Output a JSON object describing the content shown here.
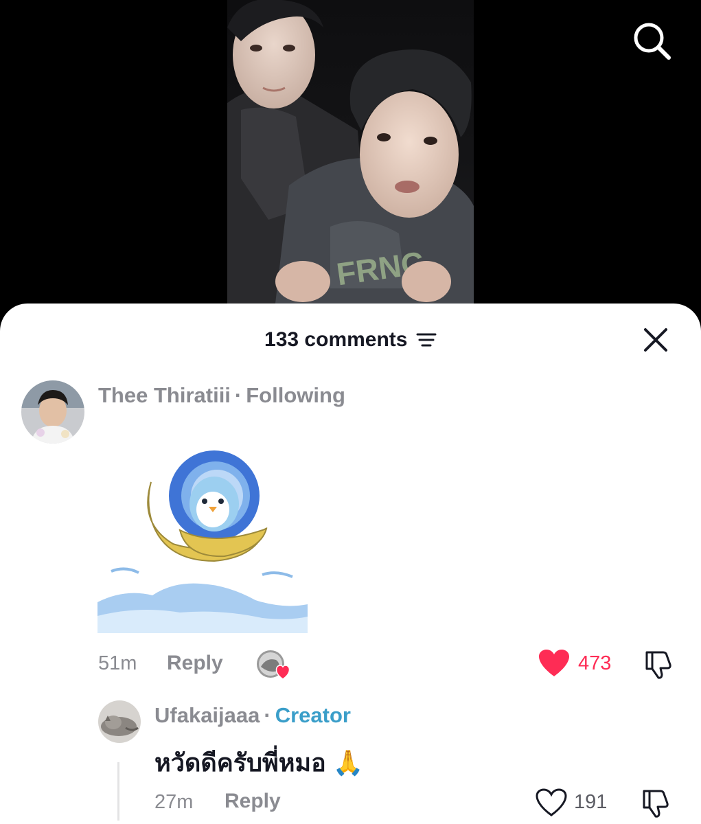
{
  "video": {
    "search_icon": "search-icon"
  },
  "comments_sheet": {
    "title": "133 comments",
    "sort_icon": "sort-lines-icon",
    "close_icon": "close-icon"
  },
  "comments": [
    {
      "author": "Thee Thiratiii",
      "relationship": "Following",
      "attachment": "penguin sticker",
      "time": "51m",
      "reply_label": "Reply",
      "liked_by_creator": true,
      "likes": "473",
      "liked": true,
      "like_color": "#fe2c55",
      "replies": [
        {
          "author": "Ufakaijaaa",
          "badge": "Creator",
          "badge_color": "#3a9ec9",
          "text": "หวัดดีครับพี่หมอ 🙏",
          "time": "27m",
          "reply_label": "Reply",
          "likes": "191",
          "liked": false
        }
      ]
    }
  ]
}
